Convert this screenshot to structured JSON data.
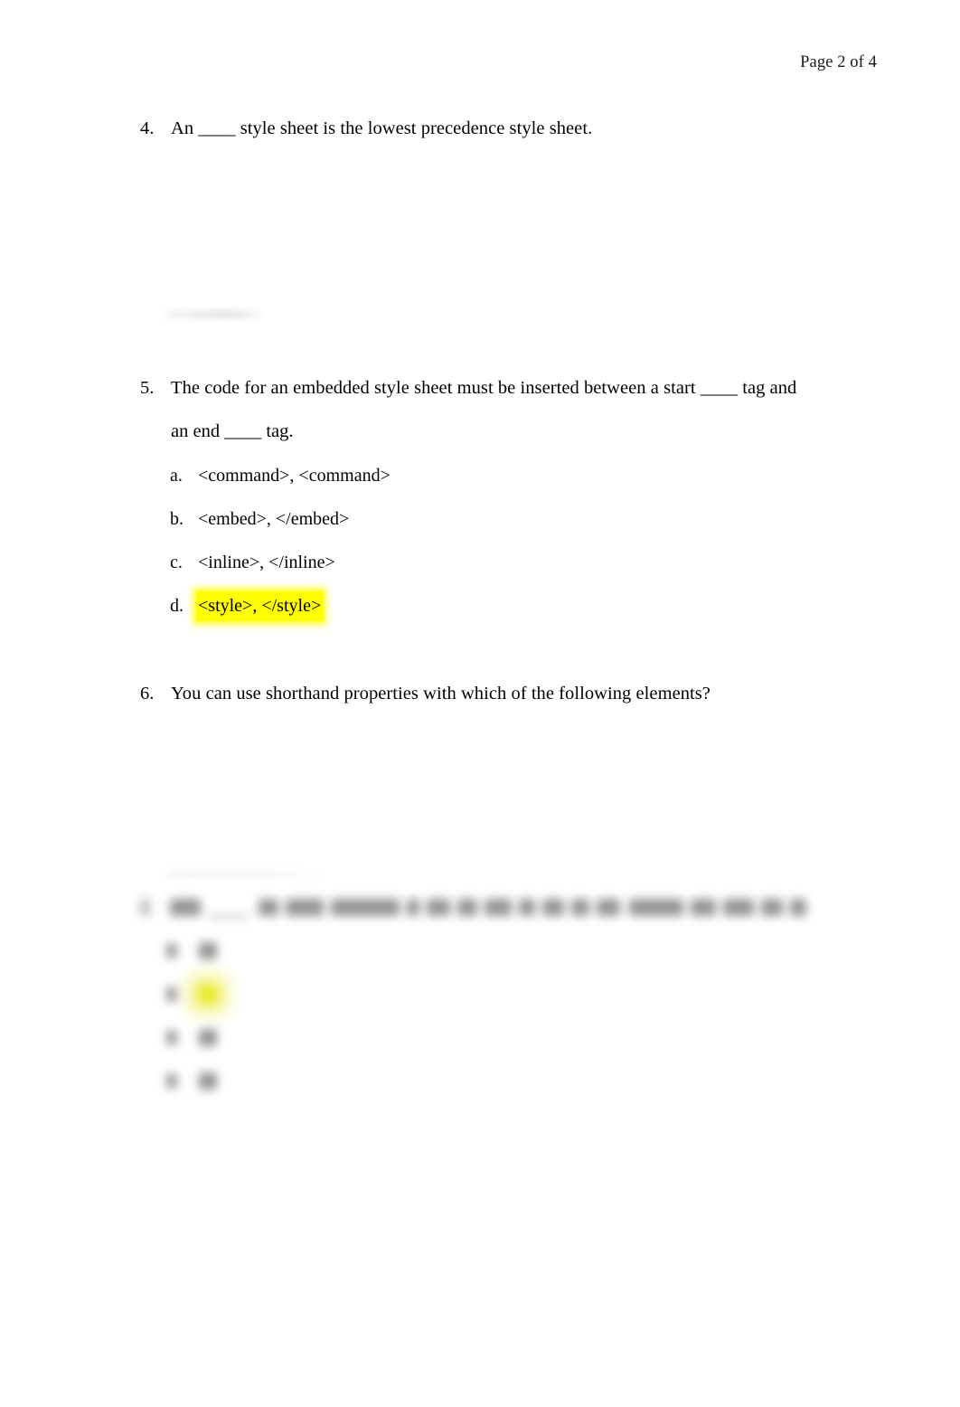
{
  "document": {
    "background_color": "#ffffff",
    "text_color": "#000000",
    "highlight_color": "#ffff00"
  },
  "header": {
    "page_label": "Page 2 of 4"
  },
  "questions": [
    {
      "number": "4.",
      "text": "An ____ style sheet is the lowest precedence style sheet.",
      "options": []
    },
    {
      "number": "5.",
      "text": "The code for an embedded style sheet must be inserted between a start ____ tag and",
      "text_continued": "an end ____ tag.",
      "options": [
        {
          "letter": "a.",
          "text": "<command>, <command>",
          "highlighted": false
        },
        {
          "letter": "b.",
          "text": "<embed>, </embed>",
          "highlighted": false
        },
        {
          "letter": "c.",
          "text": "<inline>, </inline>",
          "highlighted": false
        },
        {
          "letter": "d.",
          "text": "<style>, </style>",
          "highlighted": true
        }
      ]
    },
    {
      "number": "6.",
      "text": "You can use shorthand properties with which of the following elements?",
      "options": []
    },
    {
      "number": "7.",
      "text": "",
      "illegible": "blurred",
      "options": [
        {
          "letter": "",
          "text": "",
          "highlighted": false
        },
        {
          "letter": "",
          "text": "",
          "highlighted": true
        },
        {
          "letter": "",
          "text": "",
          "highlighted": false
        },
        {
          "letter": "",
          "text": "",
          "highlighted": false
        }
      ]
    }
  ]
}
